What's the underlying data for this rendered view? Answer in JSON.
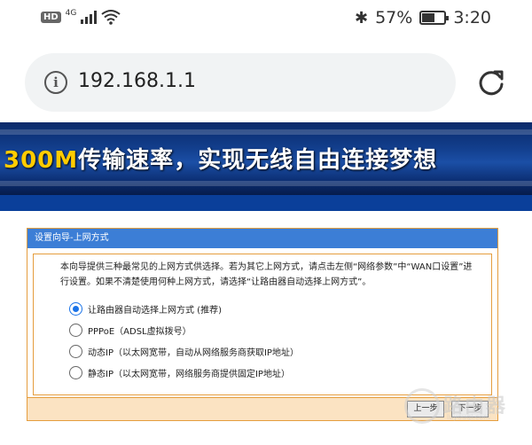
{
  "statusbar": {
    "hd": "HD",
    "network": "4G",
    "battery_percent_text": "57%",
    "battery_level": 0.57,
    "time": "3:20",
    "icons": [
      "signal-icon",
      "wifi-icon",
      "bluetooth-icon",
      "battery-icon"
    ]
  },
  "browser": {
    "url": "192.168.1.1",
    "icons": [
      "info-icon",
      "reload-icon"
    ]
  },
  "banner": {
    "highlight": "300M",
    "text": "传输速率，实现无线自由连接梦想"
  },
  "panel": {
    "title": "设置向导-上网方式",
    "intro": "本向导提供三种最常见的上网方式供选择。若为其它上网方式，请点击左侧“网络参数”中“WAN口设置”进行设置。如果不清楚使用何种上网方式，请选择“让路由器自动选择上网方式”。",
    "options": [
      {
        "label": "让路由器自动选择上网方式 (推荐)",
        "selected": true
      },
      {
        "label": "PPPoE（ADSL虚拟拨号）",
        "selected": false
      },
      {
        "label": "动态IP（以太网宽带，自动从网络服务商获取IP地址）",
        "selected": false
      },
      {
        "label": "静态IP（以太网宽带，网络服务商提供固定IP地址）",
        "selected": false
      }
    ],
    "prev_label": "上一步",
    "next_label": "下一步"
  },
  "watermark": {
    "text": "路由器",
    "sub": "luyouqi.com"
  },
  "colors": {
    "accent": "#1a73e8",
    "panel_header": "#3c7ed6",
    "panel_border": "#e59d3e",
    "footer_bg": "#fbe3c2",
    "banner_highlight": "#ffcc00"
  }
}
